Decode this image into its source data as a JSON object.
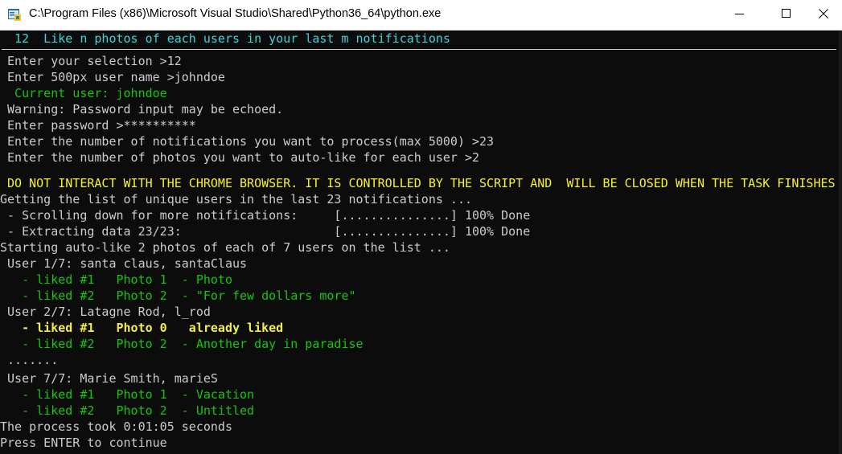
{
  "window": {
    "title": "C:\\Program Files (x86)\\Microsoft Visual Studio\\Shared\\Python36_64\\python.exe",
    "app_icon": "python-console-icon",
    "buttons": {
      "minimize": "minimize-icon",
      "maximize": "maximize-icon",
      "close": "close-icon"
    }
  },
  "colors": {
    "background": "#0c0c0c",
    "text": "#cccccc",
    "cyan": "#3ad6dc",
    "green": "#16c60c",
    "yellow": "#f9f12a"
  },
  "console": {
    "menu_header": "  12  Like n photos of each users in your last m notifications",
    "lines": [
      " Enter your selection >12",
      " Enter 500px user name >johndoe",
      "  Current user: johndoe",
      " Warning: Password input may be echoed.",
      " Enter password >**********",
      " Enter the number of notifications you want to process(max 5000) >23",
      " Enter the number of photos you want to auto-like for each user >2",
      " DO NOT INTERACT WITH THE CHROME BROWSER. IT IS CONTROLLED BY THE SCRIPT AND  WILL BE CLOSED WHEN THE TASK FINISHES",
      "Getting the list of unique users in the last 23 notifications ...",
      " - Scrolling down for more notifications:     [...............] 100% Done",
      " - Extracting data 23/23:                     [...............] 100% Done",
      "Starting auto-like 2 photos of each of 7 users on the list ...",
      " User 1/7: santa claus, santaClaus",
      "   - liked #1   Photo 1  - Photo",
      "   - liked #2   Photo 2  - \"For few dollars more\"",
      " User 2/7: Latagne Rod, l_rod",
      "   - liked #1   Photo 0   already liked",
      "   - liked #2   Photo 2  - Another day in paradise",
      " .......",
      " User 7/7: Marie Smith, marieS",
      "   - liked #1   Photo 1  - Vacation",
      "   - liked #2   Photo 2  - Untitled",
      "The process took 0:01:05 seconds",
      "Press ENTER to continue"
    ]
  }
}
